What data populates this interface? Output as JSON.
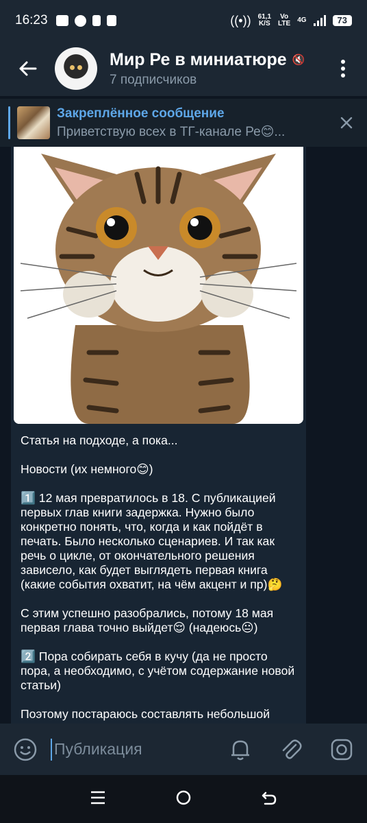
{
  "status_bar": {
    "time": "16:23",
    "net_speed": "61,1",
    "net_unit": "K/S",
    "volte": "Vo",
    "lte": "LTE",
    "network": "4G",
    "battery": "73"
  },
  "header": {
    "title": "Мир Ре в миниатюре",
    "subtitle": "7 подписчиков"
  },
  "pinned": {
    "label": "Закреплённое сообщение",
    "preview": "Приветствую всех в ТГ-канале Ре😊..."
  },
  "message": {
    "paragraphs": [
      "Статья на подходе, а пока...",
      "Новости (их немного😊)",
      "1️⃣ 12 мая превратилось в 18. С публикацией первых глав книги задержка. Нужно было конкретно понять, что, когда и как пойдёт в печать. Было несколько сценариев. И так как речь о цикле, от окончательного решения зависело, как будет выглядеть первая книга (какие события охватит, на чём акцент и пр)🤔",
      "С этим успешно разобрались, потому 18 мая первая глава точно выйдет😌 (надеюсь😐)",
      "2️⃣ Пора собирать себя в кучу (да не просто пора, а необходимо, с учётом содержание новой статьи)",
      "Поэтому постараюсь составлять небольшой план и его придерживаться. Не стой ногда:"
    ]
  },
  "input": {
    "placeholder": "Публикация"
  },
  "colors": {
    "accent": "#5ea7e8",
    "header_bg": "#1c2733",
    "chat_bg": "#0e1621",
    "bubble_bg": "#182533"
  }
}
